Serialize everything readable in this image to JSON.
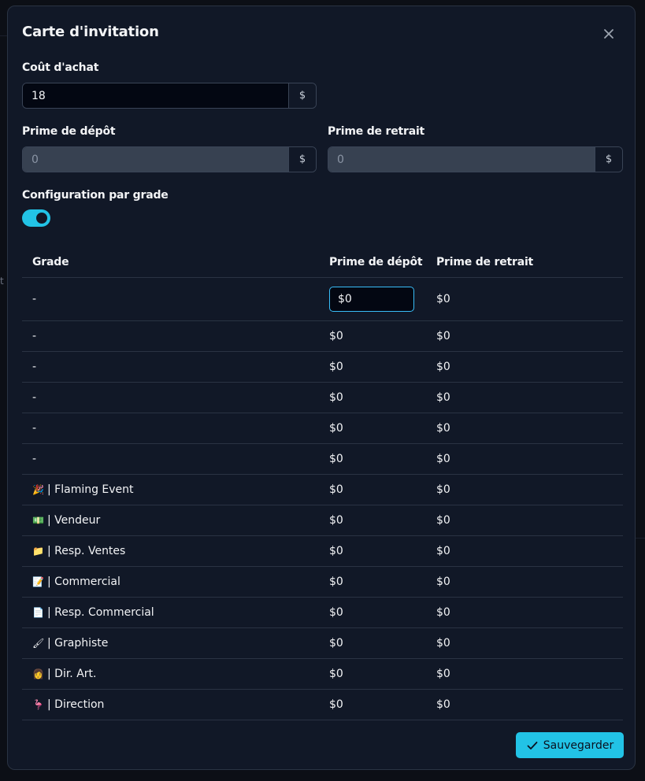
{
  "modal": {
    "title": "Carte d'invitation",
    "close_icon": "close-icon"
  },
  "form": {
    "purchase_cost": {
      "label": "Coût d'achat",
      "value": "18",
      "currency": "$"
    },
    "deposit_bonus": {
      "label": "Prime de dépôt",
      "value": "0",
      "currency": "$"
    },
    "withdraw_bonus": {
      "label": "Prime de retrait",
      "value": "0",
      "currency": "$"
    },
    "grade_config": {
      "label": "Configuration par grade",
      "enabled": true
    }
  },
  "table": {
    "headers": {
      "grade": "Grade",
      "deposit": "Prime de dépôt",
      "withdraw": "Prime de retrait"
    },
    "rows": [
      {
        "emoji": "",
        "grade": "-",
        "deposit": "$0",
        "withdraw": "$0"
      },
      {
        "emoji": "",
        "grade": "-",
        "deposit": "$0",
        "withdraw": "$0"
      },
      {
        "emoji": "",
        "grade": "-",
        "deposit": "$0",
        "withdraw": "$0"
      },
      {
        "emoji": "",
        "grade": "-",
        "deposit": "$0",
        "withdraw": "$0"
      },
      {
        "emoji": "",
        "grade": "-",
        "deposit": "$0",
        "withdraw": "$0"
      },
      {
        "emoji": "",
        "grade": "-",
        "deposit": "$0",
        "withdraw": "$0"
      },
      {
        "emoji": "🎉",
        "grade": "| Flaming Event",
        "deposit": "$0",
        "withdraw": "$0"
      },
      {
        "emoji": "💵",
        "grade": "| Vendeur",
        "deposit": "$0",
        "withdraw": "$0"
      },
      {
        "emoji": "📁",
        "grade": "| Resp. Ventes",
        "deposit": "$0",
        "withdraw": "$0"
      },
      {
        "emoji": "📝",
        "grade": "| Commercial",
        "deposit": "$0",
        "withdraw": "$0"
      },
      {
        "emoji": "📄",
        "grade": "| Resp. Commercial",
        "deposit": "$0",
        "withdraw": "$0"
      },
      {
        "emoji": "🖌",
        "grade": "| Graphiste",
        "deposit": "$0",
        "withdraw": "$0"
      },
      {
        "emoji": "👩",
        "grade": "| Dir. Art.",
        "deposit": "$0",
        "withdraw": "$0"
      },
      {
        "emoji": "🦩",
        "grade": "| Direction",
        "deposit": "$0",
        "withdraw": "$0"
      }
    ]
  },
  "actions": {
    "save_label": "Sauvegarder"
  },
  "colors": {
    "accent": "#22c3e6",
    "modal_bg": "#111827",
    "input_active": "#030712",
    "input_disabled": "#374151"
  }
}
